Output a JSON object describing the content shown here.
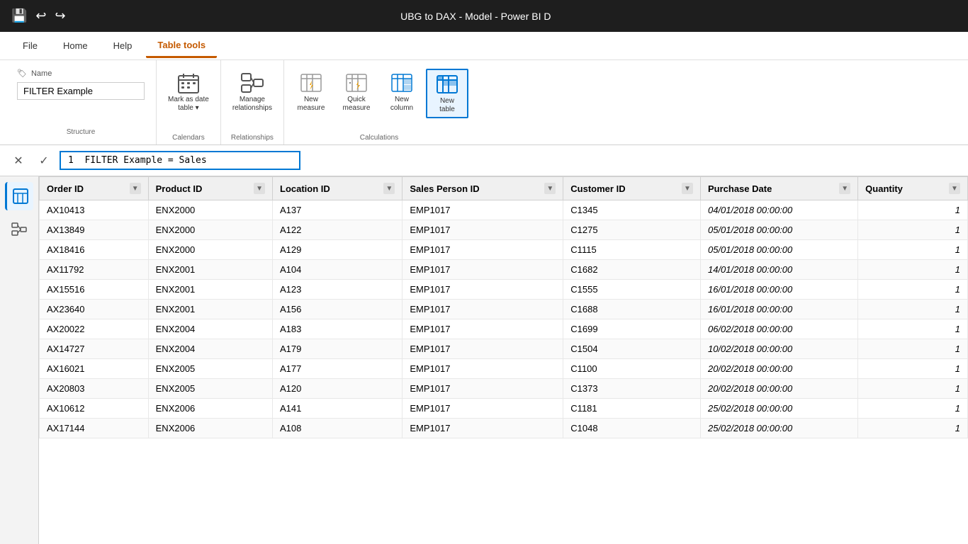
{
  "titleBar": {
    "title": "UBG to DAX - Model - Power BI D",
    "saveIcon": "💾",
    "undoIcon": "↩",
    "redoIcon": "↪"
  },
  "menuBar": {
    "items": [
      {
        "label": "File",
        "active": false
      },
      {
        "label": "Home",
        "active": false
      },
      {
        "label": "Help",
        "active": false
      },
      {
        "label": "Table tools",
        "active": true
      }
    ]
  },
  "ribbon": {
    "nameSection": {
      "label": "Name",
      "labelIcon": "🏷",
      "value": "FILTER Example",
      "sectionLabel": "Structure"
    },
    "calendarsSection": {
      "label": "Calendars",
      "buttons": [
        {
          "id": "mark-as-date-table",
          "label": "Mark as date\ntable ▾",
          "icon": "📅"
        }
      ]
    },
    "relationshipsSection": {
      "label": "Relationships",
      "buttons": [
        {
          "id": "manage-relationships",
          "label": "Manage\nrelationships",
          "icon": "🔗"
        }
      ]
    },
    "calculationsSection": {
      "label": "Calculations",
      "buttons": [
        {
          "id": "new-measure",
          "label": "New\nmeasure",
          "icon": "⚡"
        },
        {
          "id": "quick-measure",
          "label": "Quick\nmeasure",
          "icon": "⚡"
        },
        {
          "id": "new-column",
          "label": "New\ncolumn",
          "icon": "📊"
        },
        {
          "id": "new-table",
          "label": "New\ntable",
          "icon": "📋",
          "selected": true
        }
      ]
    }
  },
  "formulaBar": {
    "lineNumber": "1",
    "formula": "FILTER Example = Sales"
  },
  "sidebar": {
    "icons": [
      {
        "id": "table-view",
        "icon": "⊞",
        "active": true
      },
      {
        "id": "model-view",
        "icon": "⬡",
        "active": false
      }
    ]
  },
  "table": {
    "columns": [
      {
        "label": "Order ID"
      },
      {
        "label": "Product ID"
      },
      {
        "label": "Location ID"
      },
      {
        "label": "Sales Person ID"
      },
      {
        "label": "Customer ID"
      },
      {
        "label": "Purchase Date"
      },
      {
        "label": "Quantity"
      }
    ],
    "rows": [
      [
        "AX10413",
        "ENX2000",
        "A137",
        "EMP1017",
        "C1345",
        "04/01/2018 00:00:00",
        "1"
      ],
      [
        "AX13849",
        "ENX2000",
        "A122",
        "EMP1017",
        "C1275",
        "05/01/2018 00:00:00",
        "1"
      ],
      [
        "AX18416",
        "ENX2000",
        "A129",
        "EMP1017",
        "C1115",
        "05/01/2018 00:00:00",
        "1"
      ],
      [
        "AX11792",
        "ENX2001",
        "A104",
        "EMP1017",
        "C1682",
        "14/01/2018 00:00:00",
        "1"
      ],
      [
        "AX15516",
        "ENX2001",
        "A123",
        "EMP1017",
        "C1555",
        "16/01/2018 00:00:00",
        "1"
      ],
      [
        "AX23640",
        "ENX2001",
        "A156",
        "EMP1017",
        "C1688",
        "16/01/2018 00:00:00",
        "1"
      ],
      [
        "AX20022",
        "ENX2004",
        "A183",
        "EMP1017",
        "C1699",
        "06/02/2018 00:00:00",
        "1"
      ],
      [
        "AX14727",
        "ENX2004",
        "A179",
        "EMP1017",
        "C1504",
        "10/02/2018 00:00:00",
        "1"
      ],
      [
        "AX16021",
        "ENX2005",
        "A177",
        "EMP1017",
        "C1100",
        "20/02/2018 00:00:00",
        "1"
      ],
      [
        "AX20803",
        "ENX2005",
        "A120",
        "EMP1017",
        "C1373",
        "20/02/2018 00:00:00",
        "1"
      ],
      [
        "AX10612",
        "ENX2006",
        "A141",
        "EMP1017",
        "C1181",
        "25/02/2018 00:00:00",
        "1"
      ],
      [
        "AX17144",
        "ENX2006",
        "A108",
        "EMP1017",
        "C1048",
        "25/02/2018 00:00:00",
        "1"
      ]
    ]
  }
}
